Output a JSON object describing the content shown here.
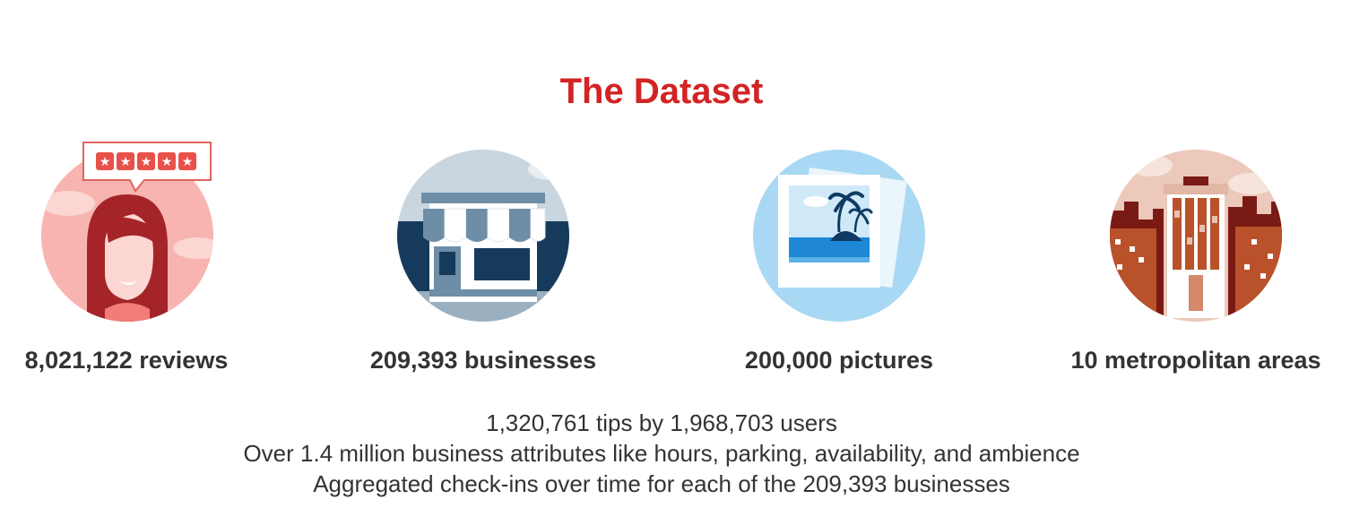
{
  "page": {
    "title": "The Dataset",
    "accent_color": "#d32323"
  },
  "stats": [
    {
      "label": "8,021,122 reviews",
      "icon": "reviewer-icon"
    },
    {
      "label": "209,393 businesses",
      "icon": "storefront-icon"
    },
    {
      "label": "200,000 pictures",
      "icon": "photo-icon"
    },
    {
      "label": "10 metropolitan areas",
      "icon": "city-icon"
    }
  ],
  "details": [
    "1,320,761 tips by 1,968,703 users",
    "Over 1.4 million business attributes like hours, parking, availability, and ambience",
    "Aggregated check-ins over time for each of the 209,393 businesses"
  ]
}
